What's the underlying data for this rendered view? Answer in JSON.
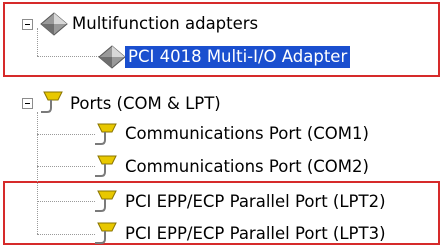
{
  "tree": {
    "multifunction": {
      "label": "Multifunction adapters",
      "children": [
        "PCI 4018 Multi-I/O Adapter"
      ]
    },
    "ports": {
      "label": "Ports (COM & LPT)",
      "children": [
        "Communications Port (COM1)",
        "Communications Port (COM2)",
        "PCI EPP/ECP Parallel Port (LPT2)",
        "PCI EPP/ECP Parallel Port (LPT3)"
      ]
    }
  },
  "colors": {
    "selection": "#1a4fcf",
    "highlight_box": "#d62a2a",
    "device_icon": "#8a8a8a",
    "port_icon": "#e0c000"
  }
}
